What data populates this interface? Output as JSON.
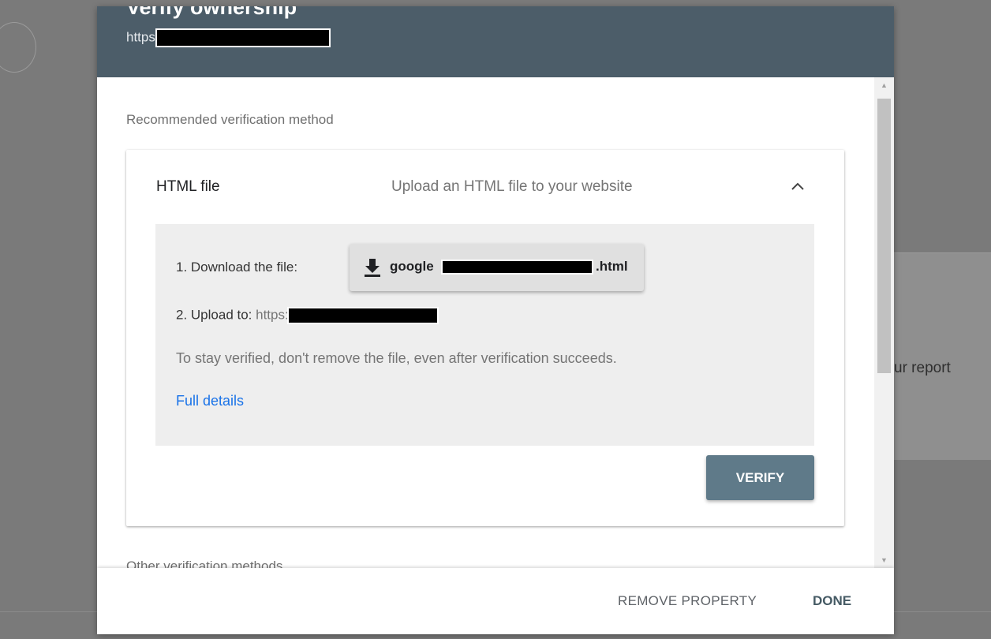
{
  "background": {
    "card_text": "ur report"
  },
  "dialog": {
    "title": "Verify ownership",
    "subtitle_prefix": "https"
  },
  "recommended": {
    "label": "Recommended verification method",
    "method": {
      "name": "HTML file",
      "description": "Upload an HTML file to your website",
      "expanded_icon": "chevron-up-icon",
      "step1_label": "1. Download the file:",
      "download_icon": "download-icon",
      "download_prefix": "google",
      "download_suffix": ".html",
      "step2_label": "2. Upload to: ",
      "step2_url_prefix": "https:",
      "note": "To stay verified, don't remove the file, even after verification succeeds.",
      "details_link": "Full details",
      "verify_label": "VERIFY"
    }
  },
  "other_methods_label": "Other verification methods",
  "footer": {
    "remove_label": "REMOVE PROPERTY",
    "done_label": "DONE"
  },
  "colors": {
    "header": "#4c5d69",
    "verify_button": "#5f7a89",
    "link": "#1a73e8",
    "panel": "#eeeeee"
  }
}
